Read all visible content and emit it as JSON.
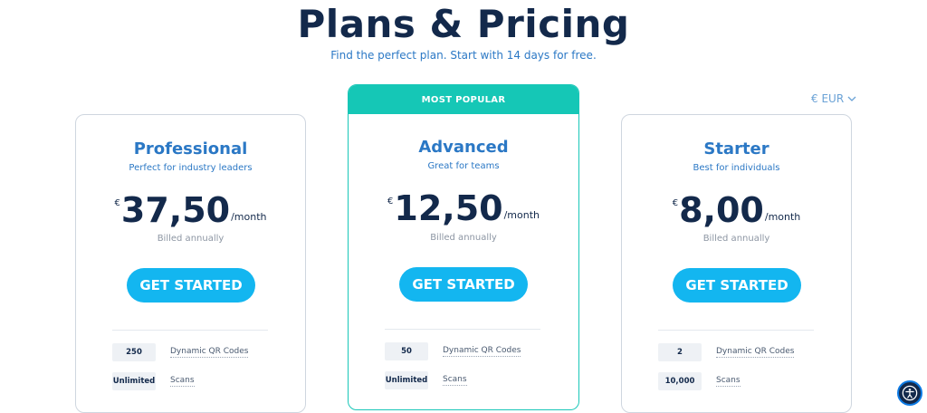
{
  "header": {
    "title": "Plans & Pricing",
    "subtitle": "Find the perfect plan. Start with 14 days for free."
  },
  "currency_selector": {
    "label": "€ EUR"
  },
  "plans": [
    {
      "name": "Professional",
      "description": "Perfect for industry leaders",
      "currency_symbol": "€",
      "price": "37,50",
      "period": "/month",
      "billing": "Billed annually",
      "cta": "GET STARTED",
      "features": [
        {
          "value": "250",
          "label": "Dynamic QR Codes"
        },
        {
          "value": "Unlimited",
          "label": "Scans"
        }
      ]
    },
    {
      "badge": "MOST POPULAR",
      "name": "Advanced",
      "description": "Great for teams",
      "currency_symbol": "€",
      "price": "12,50",
      "period": "/month",
      "billing": "Billed annually",
      "cta": "GET STARTED",
      "features": [
        {
          "value": "50",
          "label": "Dynamic QR Codes"
        },
        {
          "value": "Unlimited",
          "label": "Scans"
        }
      ]
    },
    {
      "name": "Starter",
      "description": "Best for individuals",
      "currency_symbol": "€",
      "price": "8,00",
      "period": "/month",
      "billing": "Billed annually",
      "cta": "GET STARTED",
      "features": [
        {
          "value": "2",
          "label": "Dynamic QR Codes"
        },
        {
          "value": "10,000",
          "label": "Scans"
        }
      ]
    }
  ],
  "colors": {
    "title": "#13294b",
    "accent_blue": "#2b78c5",
    "cta": "#13b6f0",
    "popular_band": "#15c7b6"
  },
  "icons": {
    "currency_dropdown": "chevron-down-icon",
    "accessibility": "accessibility-icon"
  }
}
